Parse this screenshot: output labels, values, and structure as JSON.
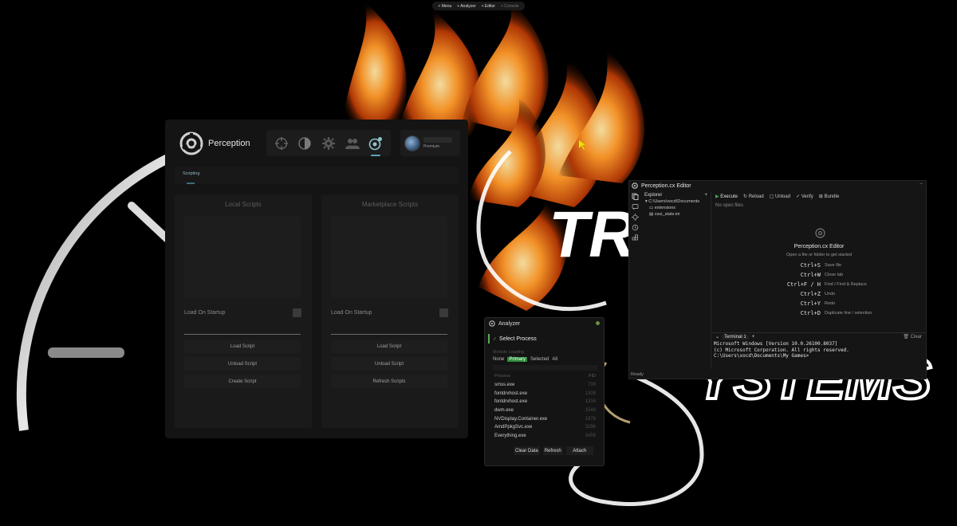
{
  "background": {
    "big_text_1": "TR",
    "big_text_2": "YSTEMS",
    "colors": {
      "flame_core": "#ffd27a",
      "flame_mid": "#ff8a1c",
      "flame_dark": "#9c2d00",
      "glow": "#ffffff"
    }
  },
  "topmenu": {
    "items": [
      "+ Menu",
      "+ Analyzer",
      "+ Editor",
      "+ Console"
    ]
  },
  "perception": {
    "app_name": "Perception",
    "nav_icons": [
      "crosshair-icon",
      "contrast-icon",
      "gear-icon",
      "users-icon",
      "scripting-icon"
    ],
    "profile_badge": "Premium",
    "active_tab": "Scripting",
    "local": {
      "title": "Local Scripts",
      "startup_label": "Load On Startup",
      "buttons": [
        "Load Script",
        "Unload Script",
        "Create Script"
      ]
    },
    "marketplace": {
      "title": "Marketplace Scripts",
      "startup_label": "Load On Startup",
      "buttons": [
        "Load Script",
        "Unload Script",
        "Refresh Scripts"
      ]
    },
    "accent": "#5aa7b5"
  },
  "analyzer": {
    "title": "Analyzer",
    "select_label": "Select Process",
    "module_loading": "Module Loading",
    "filters": [
      "None",
      "Primary",
      "Selected",
      "All"
    ],
    "active_filter": "Primary",
    "columns": [
      "Process",
      "PID"
    ],
    "rows": [
      {
        "name": "smss.exe",
        "pid": "708"
      },
      {
        "name": "fontdrvhost.exe",
        "pid": "1308"
      },
      {
        "name": "fontdrvhost.exe",
        "pid": "1316"
      },
      {
        "name": "dwm.exe",
        "pid": "1544"
      },
      {
        "name": "NVDisplay.Container.exe",
        "pid": "1976"
      },
      {
        "name": "AmdPpkgSvc.exe",
        "pid": "3296"
      },
      {
        "name": "Everything.exe",
        "pid": "3456"
      }
    ],
    "buttons": [
      "Clear Data",
      "Refresh",
      "Attach"
    ],
    "accent": "#2f8a3d"
  },
  "editor": {
    "title": "Perception.cx Editor",
    "explorer": {
      "title": "Explorer",
      "root": "C:\\Users\\xocd\\Documents",
      "items": [
        "extensions",
        "csui_state.ini"
      ]
    },
    "toolbar": [
      "Execute",
      "Reload",
      "Unload",
      "Verify",
      "Bundle"
    ],
    "no_open": "No open files",
    "welcome_title": "Perception.cx Editor",
    "welcome_sub": "Open a file or folder to get started",
    "shortcuts": [
      {
        "keys": "Ctrl+S",
        "desc": "Save file"
      },
      {
        "keys": "Ctrl+W",
        "desc": "Close tab"
      },
      {
        "keys": "Ctrl+F / H",
        "desc": "Find / Find & Replace"
      },
      {
        "keys": "Ctrl+Z",
        "desc": "Undo"
      },
      {
        "keys": "Ctrl+Y",
        "desc": "Redo"
      },
      {
        "keys": "Ctrl+D",
        "desc": "Duplicate line / selection"
      }
    ],
    "terminal_tab": "Terminal 1",
    "terminal_clear": "Clear",
    "terminal_lines": [
      "Microsoft Windows [Version 10.0.26100.8037]",
      "(c) Microsoft Corporation. All rights reserved.",
      "",
      "C:\\Users\\xocd\\Documents\\My Games>"
    ],
    "status": "Ready"
  }
}
